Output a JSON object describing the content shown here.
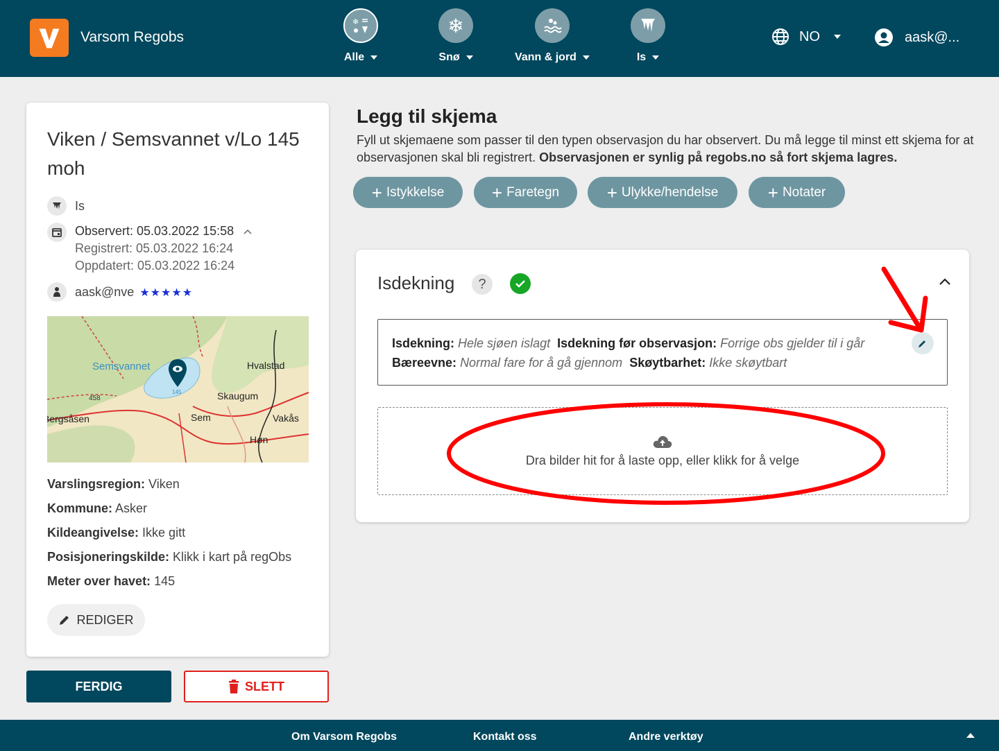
{
  "header": {
    "app_title": "Varsom Regobs",
    "nav": [
      {
        "label": "Alle"
      },
      {
        "label": "Snø"
      },
      {
        "label": "Vann & jord"
      },
      {
        "label": "Is"
      }
    ],
    "language": "NO",
    "user": "aask@..."
  },
  "location": {
    "title": "Viken / Semsvannet v/Lo 145 moh",
    "type": "Is",
    "observed": "Observert: 05.03.2022 15:58",
    "registered": "Registrert: 05.03.2022 16:24",
    "updated": "Oppdatert: 05.03.2022 16:24",
    "observer": "aask@nve",
    "stars": "★★★★★",
    "map_labels": {
      "lake": "Semsvannet",
      "elevation": "458",
      "lake_elev": "145",
      "place1": "Hvalstad",
      "place2": "Skaugum",
      "place3": "Sem",
      "place4": "Vakås",
      "place5": "Høn",
      "place6": "Bergsåsen"
    },
    "props": [
      {
        "key": "Varslingsregion:",
        "value": " Viken"
      },
      {
        "key": "Kommune:",
        "value": " Asker"
      },
      {
        "key": "Kildeangivelse:",
        "value": " Ikke gitt"
      },
      {
        "key": "Posisjoneringskilde:",
        "value": " Klikk i kart på regObs"
      },
      {
        "key": "Meter over havet:",
        "value": " 145"
      }
    ],
    "edit_label": "REDIGER"
  },
  "actions": {
    "done_label": "FERDIG",
    "delete_label": "SLETT"
  },
  "section": {
    "title": "Legg til skjema",
    "desc_plain": "Fyll ut skjemaene som passer til den typen observasjon du har observert. Du må legge til minst ett skjema for at observasjonen skal bli registrert. ",
    "desc_bold": "Observasjonen er synlig på regobs.no så fort skjema lagres.",
    "add_buttons": [
      "Istykkelse",
      "Faretegn",
      "Ulykke/hendelse",
      "Notater"
    ]
  },
  "form": {
    "title": "Isdekning",
    "help": "?",
    "fields": {
      "isdekning_key": "Isdekning:",
      "isdekning_val": "Hele sjøen islagt",
      "before_key": "Isdekning før observasjon:",
      "before_val": "Forrige obs gjelder til i går",
      "baereevne_key": "Bæreevne:",
      "baereevne_val": "Normal fare for å gå gjennom",
      "skoyte_key": "Skøytbarhet:",
      "skoyte_val": "Ikke skøytbart"
    },
    "upload_text": "Dra bilder hit for å laste opp, eller klikk for å velge"
  },
  "footer": {
    "links": [
      "Om Varsom Regobs",
      "Kontakt oss",
      "Andre verktøy"
    ]
  },
  "colors": {
    "primary": "#01475d",
    "logo": "#f47b20",
    "pill": "#6e96a1",
    "danger": "#e0201b",
    "ok": "#17a626",
    "annotation": "#ff0000"
  }
}
